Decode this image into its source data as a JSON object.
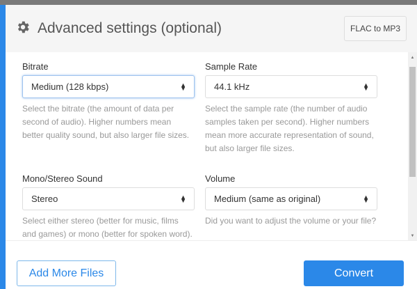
{
  "header": {
    "title": "Advanced settings (optional)",
    "format_button": "FLAC to MP3",
    "icon": "gear-icon"
  },
  "fields": [
    {
      "label": "Bitrate",
      "value": "Medium (128 kbps)",
      "help": "Select the bitrate (the amount of data per second of audio). Higher numbers mean better quality sound, but also larger file sizes."
    },
    {
      "label": "Sample Rate",
      "value": "44.1 kHz",
      "help": "Select the sample rate (the number of audio samples taken per second). Higher numbers mean more accurate representation of sound, but also larger file sizes."
    },
    {
      "label": "Mono/Stereo Sound",
      "value": "Stereo",
      "help": "Select either stereo (better for music, films and games) or mono (better for spoken word)."
    },
    {
      "label": "Volume",
      "value": "Medium (same as original)",
      "help": "Did you want to adjust the volume or your file?"
    }
  ],
  "footer": {
    "add_files": "Add More Files",
    "convert": "Convert"
  },
  "colors": {
    "accent": "#2b88e8"
  }
}
